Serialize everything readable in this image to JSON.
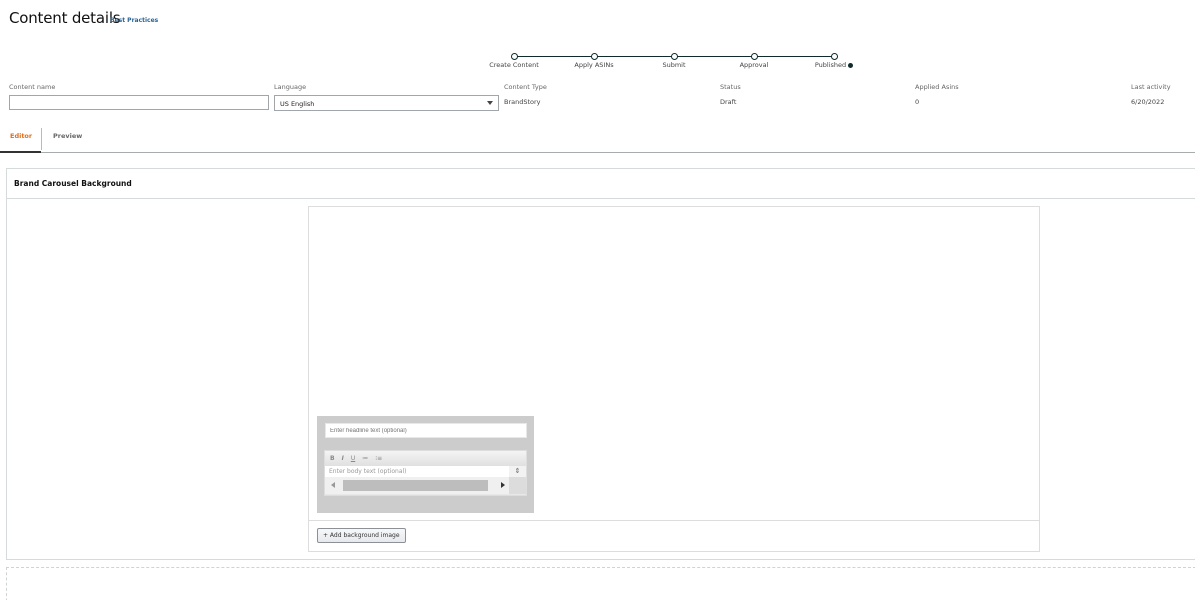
{
  "header": {
    "title": "Content details",
    "best_practices_link": "Best Practices"
  },
  "stepper": {
    "steps": [
      {
        "label": "Create Content"
      },
      {
        "label": "Apply ASINs"
      },
      {
        "label": "Submit"
      },
      {
        "label": "Approval"
      },
      {
        "label": "Published"
      }
    ],
    "info_icon": "info-icon"
  },
  "meta": {
    "content_name": {
      "label": "Content name",
      "value": ""
    },
    "language": {
      "label": "Language",
      "value": "US English"
    },
    "content_type": {
      "label": "Content Type",
      "value": "BrandStory"
    },
    "status": {
      "label": "Status",
      "value": "Draft"
    },
    "applied_asins": {
      "label": "Applied Asins",
      "value": "0"
    },
    "last_activity": {
      "label": "Last activity",
      "value": "6/20/2022"
    }
  },
  "tabs": [
    {
      "label": "Editor",
      "active": true
    },
    {
      "label": "Preview",
      "active": false
    }
  ],
  "module": {
    "title": "Brand Carousel Background",
    "headline_placeholder": "Enter headline text (optional)",
    "body_placeholder": "Enter body text (optional)",
    "toolbar": {
      "bold": "B",
      "italic": "I",
      "underline": "U",
      "bullet_list": "≔",
      "numbered_list": "⁝≡"
    },
    "add_background_label": "+ Add background image"
  },
  "colors": {
    "active_tab": "#e36d1a",
    "link": "#2a6496",
    "stepper": "#0f2b2b"
  }
}
